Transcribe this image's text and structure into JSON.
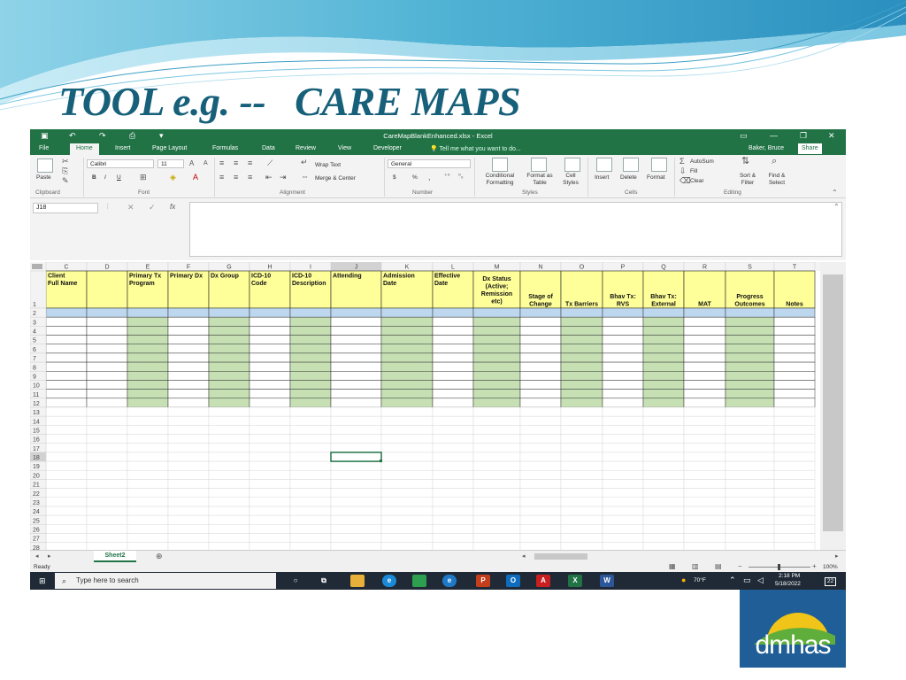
{
  "slide": {
    "title": "TOOL e.g. --   CARE MAPS"
  },
  "colors": {
    "excel_green": "#217346",
    "title_teal": "#17607a",
    "header_yellow": "#ffff99",
    "column_green": "#c6e0b4",
    "selected_row_blue": "#bdd7ee",
    "logo_blue": "#1f5e96",
    "logo_yellow": "#f0c419"
  },
  "excel": {
    "document_title": "CareMapBlankEnhanced.xlsx - Excel",
    "tabs": [
      "File",
      "Home",
      "Insert",
      "Page Layout",
      "Formulas",
      "Data",
      "Review",
      "View",
      "Developer"
    ],
    "active_tab": "Home",
    "tell_me": "Tell me what you want to do...",
    "user_name": "Baker, Bruce",
    "share_label": "Share",
    "ribbon": {
      "clipboard": {
        "paste": "Paste",
        "label": "Clipboard"
      },
      "font": {
        "name": "Calibri",
        "size": "11",
        "label": "Font",
        "bold": "B",
        "italic": "I",
        "underline": "U"
      },
      "alignment": {
        "wrap_text": "Wrap Text",
        "merge_center": "Merge & Center",
        "label": "Alignment"
      },
      "number": {
        "format": "General",
        "currency": "$",
        "percent": "%",
        "label": "Number"
      },
      "styles": {
        "conditional": "Conditional Formatting",
        "format_table": "Format as Table",
        "cell_styles": "Cell Styles",
        "label": "Styles"
      },
      "cells": {
        "insert": "Insert",
        "delete": "Delete",
        "format": "Format",
        "label": "Cells"
      },
      "editing": {
        "autosum": "AutoSum",
        "fill": "Fill",
        "clear": "Clear",
        "sort_filter": "Sort & Filter",
        "find_select": "Find & Select",
        "label": "Editing"
      }
    },
    "name_box": "J18",
    "sheet": {
      "columns": [
        {
          "letter": "C",
          "header": "Client Full Name",
          "fill": "white"
        },
        {
          "letter": "D",
          "header": "",
          "fill": "white"
        },
        {
          "letter": "E",
          "header": "Primary Tx Program",
          "fill": "green"
        },
        {
          "letter": "F",
          "header": "Primary Dx",
          "fill": "white"
        },
        {
          "letter": "G",
          "header": "Dx Group",
          "fill": "green"
        },
        {
          "letter": "H",
          "header": "ICD-10 Code",
          "fill": "white"
        },
        {
          "letter": "I",
          "header": "ICD-10 Description",
          "fill": "green"
        },
        {
          "letter": "J",
          "header": "Attending",
          "fill": "white"
        },
        {
          "letter": "K",
          "header": "Admission Date",
          "fill": "green"
        },
        {
          "letter": "L",
          "header": "Effective Date",
          "fill": "white"
        },
        {
          "letter": "M",
          "header": "Dx Status (Active; Remission etc)",
          "fill": "green"
        },
        {
          "letter": "N",
          "header": "Stage of Change",
          "fill": "white"
        },
        {
          "letter": "O",
          "header": "Tx Barriers",
          "fill": "green"
        },
        {
          "letter": "P",
          "header": "Bhav Tx: RVS",
          "fill": "white"
        },
        {
          "letter": "Q",
          "header": "Bhav Tx: External",
          "fill": "green"
        },
        {
          "letter": "R",
          "header": "MAT",
          "fill": "white"
        },
        {
          "letter": "S",
          "header": "Progress Outcomes",
          "fill": "green"
        },
        {
          "letter": "T",
          "header": "Notes",
          "fill": "white"
        }
      ],
      "header_align": [
        "top",
        "top",
        "top",
        "top",
        "top",
        "top",
        "top",
        "top",
        "top",
        "top",
        "center",
        "bottom",
        "bottom",
        "bottom",
        "bottom",
        "bottom",
        "bottom",
        "bottom"
      ],
      "rows": [
        "1",
        "2",
        "3",
        "4",
        "5",
        "6",
        "7",
        "8",
        "9",
        "10",
        "11",
        "12",
        "13",
        "14",
        "15",
        "16",
        "17",
        "18",
        "19",
        "20",
        "21",
        "22",
        "23",
        "24",
        "25",
        "26",
        "27",
        "28"
      ],
      "tab_name": "Sheet2"
    },
    "status": {
      "ready": "Ready",
      "zoom": "100%"
    },
    "taskbar": {
      "search_placeholder": "Type here to search",
      "weather": "70°F",
      "time": "2:18 PM",
      "date": "5/18/2022",
      "notifications": "22"
    }
  },
  "logo": {
    "text": "dmhas"
  }
}
